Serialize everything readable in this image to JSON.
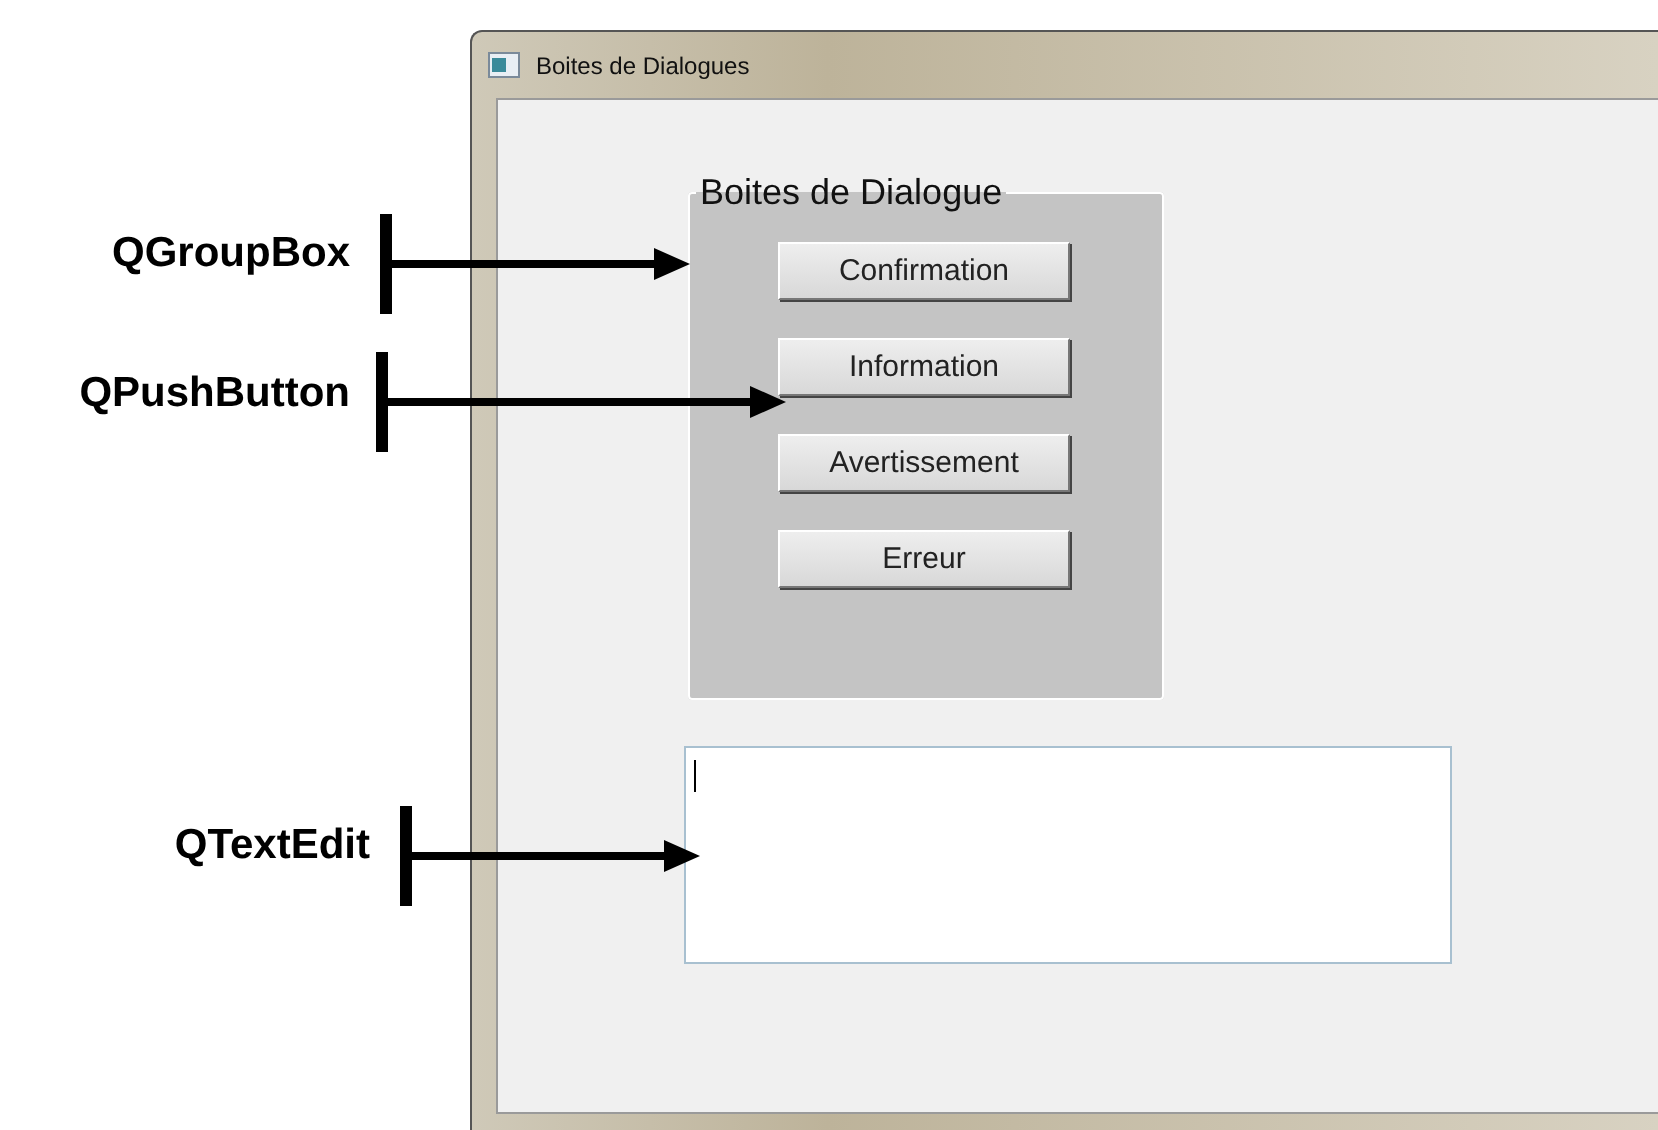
{
  "window": {
    "title": "Boites de Dialogues"
  },
  "group_box": {
    "title": "Boites de Dialogue",
    "buttons": [
      "Confirmation",
      "Information",
      "Avertissement",
      "Erreur"
    ]
  },
  "text_edit": {
    "focused": true
  },
  "annotations": [
    {
      "label": "QGroupBox"
    },
    {
      "label": "QPushButton"
    },
    {
      "label": "QTextEdit"
    }
  ]
}
